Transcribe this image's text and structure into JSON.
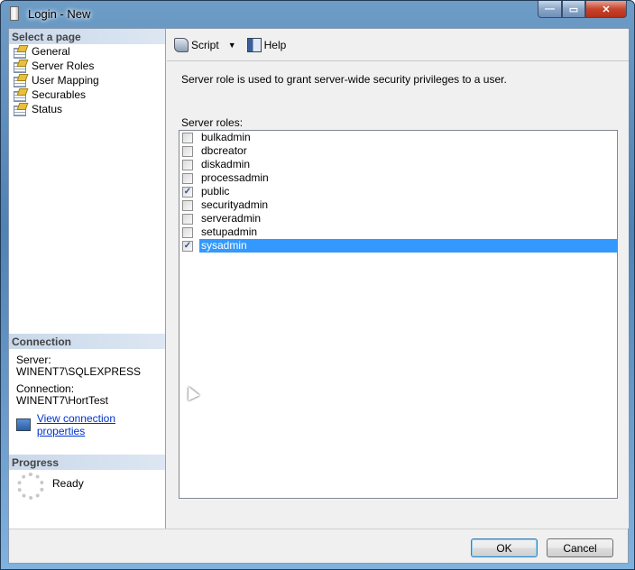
{
  "window": {
    "title": "Login - New",
    "controls": {
      "minimize": "—",
      "maximize": "▭",
      "close": "✕"
    }
  },
  "sidebar": {
    "header": "Select a page",
    "items": [
      {
        "label": "General",
        "icon": "page-icon"
      },
      {
        "label": "Server Roles",
        "icon": "page-icon",
        "selected": true
      },
      {
        "label": "User Mapping",
        "icon": "page-icon"
      },
      {
        "label": "Securables",
        "icon": "page-icon"
      },
      {
        "label": "Status",
        "icon": "page-icon"
      }
    ]
  },
  "connection": {
    "header": "Connection",
    "server_label": "Server:",
    "server_value": "WINENT7\\SQLEXPRESS",
    "connection_label": "Connection:",
    "connection_value": "WINENT7\\HortTest",
    "link": "View connection properties"
  },
  "progress": {
    "header": "Progress",
    "status": "Ready"
  },
  "toolbar": {
    "script_label": "Script",
    "help_label": "Help"
  },
  "main": {
    "description": "Server role is used to grant server-wide security privileges to a user.",
    "roles_label": "Server roles:",
    "roles": [
      {
        "name": "bulkadmin",
        "checked": false
      },
      {
        "name": "dbcreator",
        "checked": false
      },
      {
        "name": "diskadmin",
        "checked": false
      },
      {
        "name": "processadmin",
        "checked": false
      },
      {
        "name": "public",
        "checked": true
      },
      {
        "name": "securityadmin",
        "checked": false
      },
      {
        "name": "serveradmin",
        "checked": false
      },
      {
        "name": "setupadmin",
        "checked": false
      },
      {
        "name": "sysadmin",
        "checked": true,
        "selected": true
      }
    ]
  },
  "buttons": {
    "ok": "OK",
    "cancel": "Cancel"
  },
  "colors": {
    "selection": "#3399ff",
    "link": "#0033cc"
  }
}
